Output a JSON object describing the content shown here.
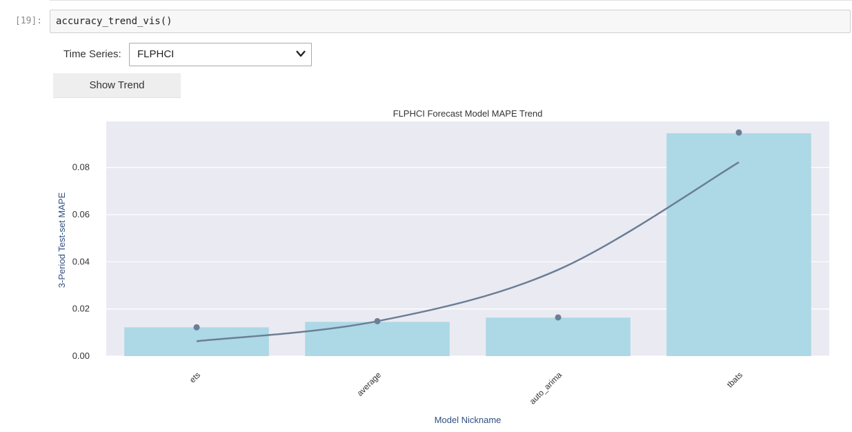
{
  "notebook": {
    "prompt": "[19]:",
    "code": "accuracy_trend_vis()"
  },
  "widgets": {
    "time_series_label": "Time Series:",
    "time_series_value": "FLPHCI",
    "show_trend_label": "Show Trend"
  },
  "colors": {
    "plot_bg": "#eaeaf2",
    "bar": "#add8e6",
    "point": "#6b7e95",
    "trend": "#6b7e95",
    "axis_label": "#2f4f7f"
  },
  "chart_data": {
    "type": "bar",
    "title": "FLPHCI Forecast Model MAPE Trend",
    "xlabel": "Model Nickname",
    "ylabel": "3-Period Test-set MAPE",
    "categories": [
      "ets",
      "average",
      "auto_arima",
      "tbats"
    ],
    "values": [
      0.0122,
      0.0145,
      0.0163,
      0.0945
    ],
    "points": [
      0.0122,
      0.0148,
      0.0164,
      0.0948
    ],
    "trend": [
      0.0063,
      0.0148,
      0.0366,
      0.0822
    ],
    "ylim": [
      0,
      0.0995
    ],
    "yticks": [
      0.0,
      0.02,
      0.04,
      0.06,
      0.08
    ],
    "ytick_labels": [
      "0.00",
      "0.02",
      "0.04",
      "0.06",
      "0.08"
    ],
    "grid": true
  }
}
